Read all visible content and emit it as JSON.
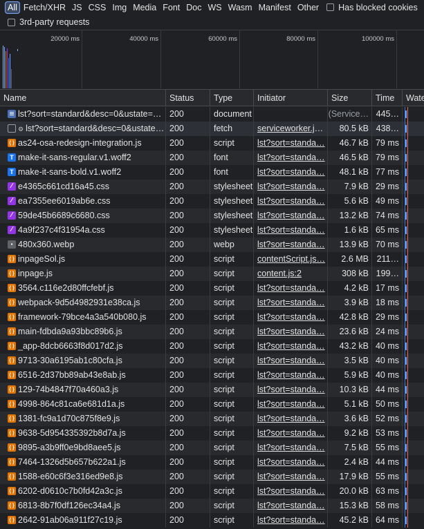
{
  "filters": {
    "types": [
      "All",
      "Fetch/XHR",
      "JS",
      "CSS",
      "Img",
      "Media",
      "Font",
      "Doc",
      "WS",
      "Wasm",
      "Manifest",
      "Other"
    ],
    "active": "All",
    "blocked_label": "Has blocked cookies",
    "third_party_label": "3rd-party requests"
  },
  "overview": {
    "ticks": [
      "20000 ms",
      "40000 ms",
      "60000 ms",
      "80000 ms",
      "100000 ms"
    ]
  },
  "table": {
    "columns": [
      "Name",
      "Status",
      "Type",
      "Initiator",
      "Size",
      "Time",
      "Waterfall"
    ],
    "rows": [
      {
        "icon": "document-icon",
        "name": "lst?sort=standard&desc=0&ustate=…",
        "status": "200",
        "type": "document",
        "initiator": "",
        "size": "(Service…",
        "time": "445…",
        "link": false,
        "dim_size": true
      },
      {
        "icon": "fetch-icon",
        "name": "lst?sort=standard&desc=0&ustate…",
        "status": "200",
        "type": "fetch",
        "initiator": "serviceworker.js…",
        "size": "80.5 kB",
        "time": "438…",
        "link": true,
        "gear": true
      },
      {
        "icon": "script-icon",
        "name": "as24-osa-redesign-integration.js",
        "status": "200",
        "type": "script",
        "initiator": "lst?sort=standa…",
        "size": "46.7 kB",
        "time": "79 ms",
        "link": true
      },
      {
        "icon": "font-icon",
        "name": "make-it-sans-regular.v1.woff2",
        "status": "200",
        "type": "font",
        "initiator": "lst?sort=standa…",
        "size": "46.5 kB",
        "time": "79 ms",
        "link": true
      },
      {
        "icon": "font-icon",
        "name": "make-it-sans-bold.v1.woff2",
        "status": "200",
        "type": "font",
        "initiator": "lst?sort=standa…",
        "size": "48.1 kB",
        "time": "77 ms",
        "link": true
      },
      {
        "icon": "stylesheet-icon",
        "name": "e4365c661cd16a45.css",
        "status": "200",
        "type": "stylesheet",
        "initiator": "lst?sort=standa…",
        "size": "7.9 kB",
        "time": "29 ms",
        "link": true
      },
      {
        "icon": "stylesheet-icon",
        "name": "ea7355ee6019ab6e.css",
        "status": "200",
        "type": "stylesheet",
        "initiator": "lst?sort=standa…",
        "size": "5.6 kB",
        "time": "49 ms",
        "link": true
      },
      {
        "icon": "stylesheet-icon",
        "name": "59de45b6689c6680.css",
        "status": "200",
        "type": "stylesheet",
        "initiator": "lst?sort=standa…",
        "size": "13.2 kB",
        "time": "74 ms",
        "link": true
      },
      {
        "icon": "stylesheet-icon",
        "name": "4a9f237c4f31954a.css",
        "status": "200",
        "type": "stylesheet",
        "initiator": "lst?sort=standa…",
        "size": "1.6 kB",
        "time": "65 ms",
        "link": true
      },
      {
        "icon": "image-icon",
        "name": "480x360.webp",
        "status": "200",
        "type": "webp",
        "initiator": "lst?sort=standa…",
        "size": "13.9 kB",
        "time": "70 ms",
        "link": true
      },
      {
        "icon": "script-icon",
        "name": "inpageSol.js",
        "status": "200",
        "type": "script",
        "initiator": "contentScript.js…",
        "size": "2.6 MB",
        "time": "211…",
        "link": true
      },
      {
        "icon": "script-icon",
        "name": "inpage.js",
        "status": "200",
        "type": "script",
        "initiator": "content.js:2",
        "size": "308 kB",
        "time": "199…",
        "link": true
      },
      {
        "icon": "script-icon",
        "name": "3564.c116e2d80ffcfebf.js",
        "status": "200",
        "type": "script",
        "initiator": "lst?sort=standa…",
        "size": "4.2 kB",
        "time": "17 ms",
        "link": true
      },
      {
        "icon": "script-icon",
        "name": "webpack-9d5d4982931e38ca.js",
        "status": "200",
        "type": "script",
        "initiator": "lst?sort=standa…",
        "size": "3.9 kB",
        "time": "18 ms",
        "link": true
      },
      {
        "icon": "script-icon",
        "name": "framework-79bce4a3a540b080.js",
        "status": "200",
        "type": "script",
        "initiator": "lst?sort=standa…",
        "size": "42.8 kB",
        "time": "29 ms",
        "link": true
      },
      {
        "icon": "script-icon",
        "name": "main-fdbda9a93bbc89b6.js",
        "status": "200",
        "type": "script",
        "initiator": "lst?sort=standa…",
        "size": "23.6 kB",
        "time": "24 ms",
        "link": true
      },
      {
        "icon": "script-icon",
        "name": "_app-8dcb6663f8d017d2.js",
        "status": "200",
        "type": "script",
        "initiator": "lst?sort=standa…",
        "size": "43.2 kB",
        "time": "40 ms",
        "link": true
      },
      {
        "icon": "script-icon",
        "name": "9713-30a6195ab1c80cfa.js",
        "status": "200",
        "type": "script",
        "initiator": "lst?sort=standa…",
        "size": "3.5 kB",
        "time": "40 ms",
        "link": true
      },
      {
        "icon": "script-icon",
        "name": "6516-2d37bb89ab43e8ab.js",
        "status": "200",
        "type": "script",
        "initiator": "lst?sort=standa…",
        "size": "5.9 kB",
        "time": "40 ms",
        "link": true
      },
      {
        "icon": "script-icon",
        "name": "129-74b4847f70a460a3.js",
        "status": "200",
        "type": "script",
        "initiator": "lst?sort=standa…",
        "size": "10.3 kB",
        "time": "44 ms",
        "link": true
      },
      {
        "icon": "script-icon",
        "name": "4998-864c81ca6e681d1a.js",
        "status": "200",
        "type": "script",
        "initiator": "lst?sort=standa…",
        "size": "5.1 kB",
        "time": "50 ms",
        "link": true
      },
      {
        "icon": "script-icon",
        "name": "1381-fc9a1d70c875f8e9.js",
        "status": "200",
        "type": "script",
        "initiator": "lst?sort=standa…",
        "size": "3.6 kB",
        "time": "52 ms",
        "link": true
      },
      {
        "icon": "script-icon",
        "name": "9638-5d954335392b8d7a.js",
        "status": "200",
        "type": "script",
        "initiator": "lst?sort=standa…",
        "size": "9.2 kB",
        "time": "53 ms",
        "link": true
      },
      {
        "icon": "script-icon",
        "name": "9895-a3b9ff0e9bd8aee5.js",
        "status": "200",
        "type": "script",
        "initiator": "lst?sort=standa…",
        "size": "7.5 kB",
        "time": "55 ms",
        "link": true
      },
      {
        "icon": "script-icon",
        "name": "7464-1326d5b657b622a1.js",
        "status": "200",
        "type": "script",
        "initiator": "lst?sort=standa…",
        "size": "2.4 kB",
        "time": "44 ms",
        "link": true
      },
      {
        "icon": "script-icon",
        "name": "1588-e60c6f3e316ed9e8.js",
        "status": "200",
        "type": "script",
        "initiator": "lst?sort=standa…",
        "size": "17.9 kB",
        "time": "55 ms",
        "link": true
      },
      {
        "icon": "script-icon",
        "name": "6202-d0610c7b0fd42a3c.js",
        "status": "200",
        "type": "script",
        "initiator": "lst?sort=standa…",
        "size": "20.0 kB",
        "time": "63 ms",
        "link": true
      },
      {
        "icon": "script-icon",
        "name": "6813-8b7f0df126ec34a4.js",
        "status": "200",
        "type": "script",
        "initiator": "lst?sort=standa…",
        "size": "15.3 kB",
        "time": "58 ms",
        "link": true
      },
      {
        "icon": "script-icon",
        "name": "2642-91ab06a911f27c19.js",
        "status": "200",
        "type": "script",
        "initiator": "lst?sort=standa…",
        "size": "45.2 kB",
        "time": "64 ms",
        "link": true
      }
    ]
  }
}
